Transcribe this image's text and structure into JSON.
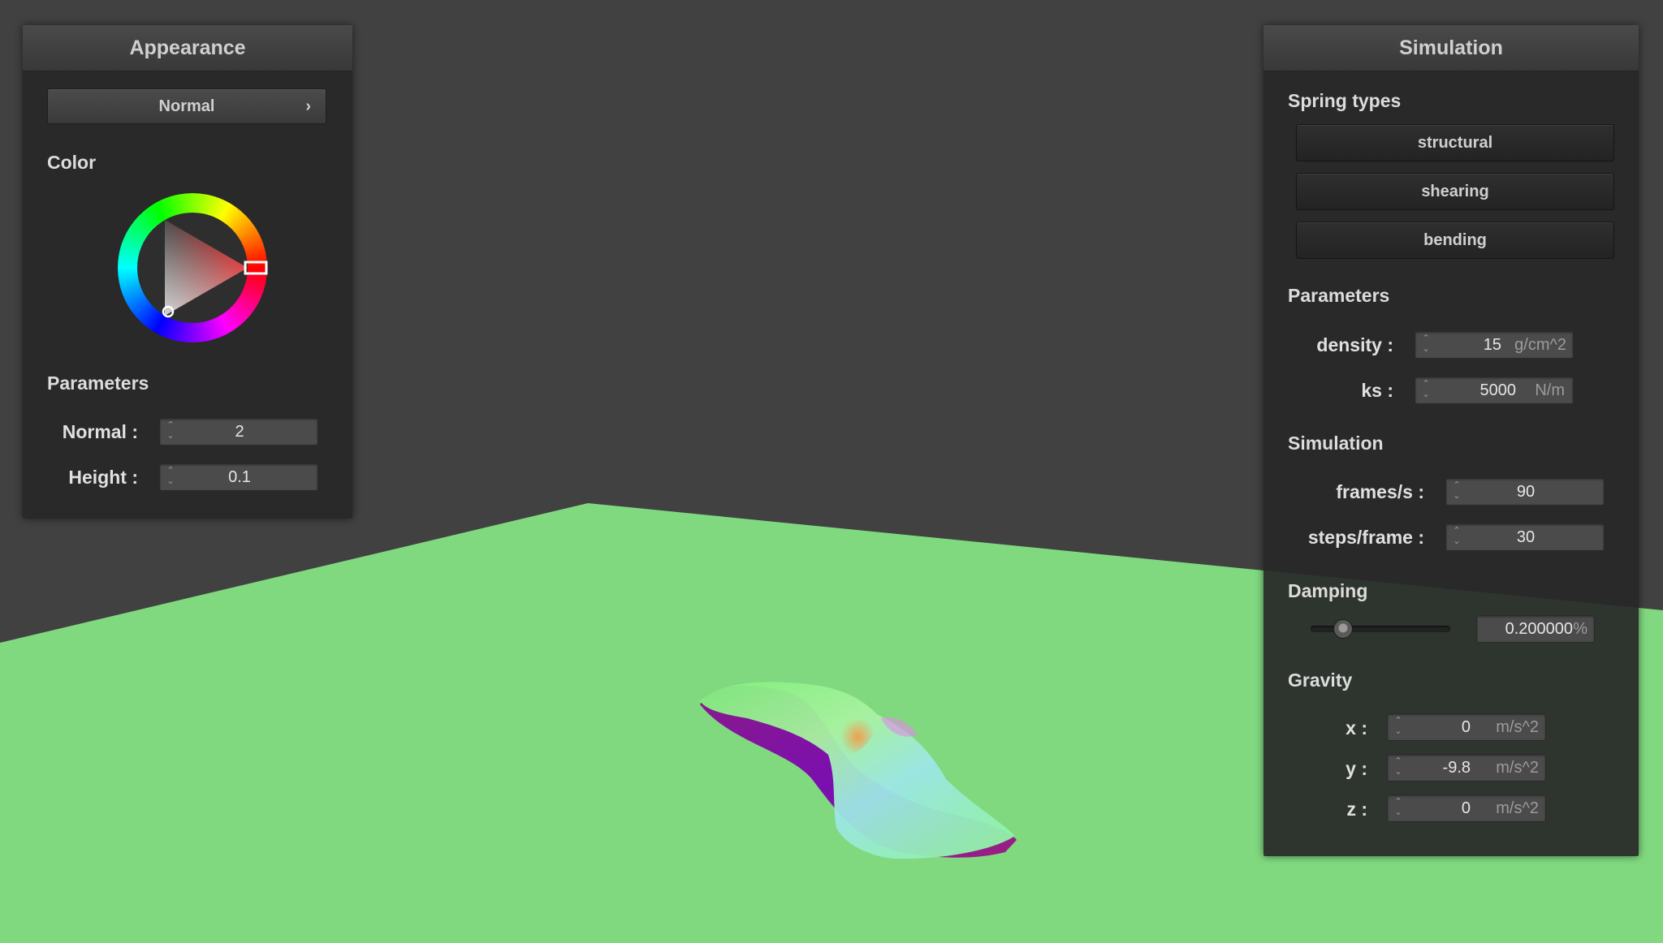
{
  "appearance": {
    "title": "Appearance",
    "shader_select": "Normal",
    "color_label": "Color",
    "params_label": "Parameters",
    "normal_label": "Normal :",
    "normal_value": "2",
    "height_label": "Height :",
    "height_value": "0.1",
    "selected_color": "#e52020"
  },
  "simulation": {
    "title": "Simulation",
    "spring_types_label": "Spring types",
    "spring_buttons": [
      "structural",
      "shearing",
      "bending"
    ],
    "params_label": "Parameters",
    "density_label": "density :",
    "density_value": "15",
    "density_unit": "g/cm^2",
    "ks_label": "ks :",
    "ks_value": "5000",
    "ks_unit": "N/m",
    "sim_label": "Simulation",
    "fps_label": "frames/s :",
    "fps_value": "90",
    "steps_label": "steps/frame :",
    "steps_value": "30",
    "damping_label": "Damping",
    "damping_value": "0.200000",
    "damping_unit": "%",
    "damping_slider_level": 0.2,
    "gravity_label": "Gravity",
    "gx_label": "x :",
    "gx_value": "0",
    "gy_label": "y :",
    "gy_value": "-9.8",
    "gz_label": "z :",
    "gz_value": "0",
    "g_unit": "m/s^2"
  },
  "colors": {
    "background": "#414141",
    "floor": "#80d97f",
    "panel": "#282828"
  }
}
